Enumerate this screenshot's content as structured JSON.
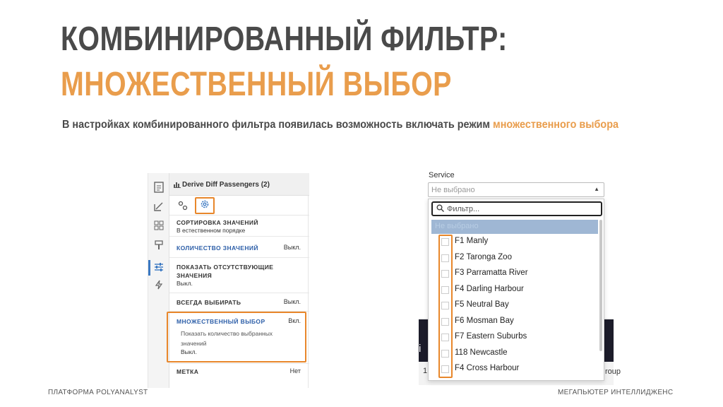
{
  "slide": {
    "title_line1": "КОМБИНИРОВАННЫЙ ФИЛЬТР:",
    "title_line2": "МНОЖЕСТВЕННЫЙ ВЫБОР",
    "subtitle_main": "В настройках комбинированного фильтра появилась возможность включать режим ",
    "subtitle_highlight": "множественного выбора",
    "footer_left": "ПЛАТФОРМА POLYANALYST",
    "footer_right": "МЕГАПЬЮТЕР ИНТЕЛЛИДЖЕНС",
    "accent_color": "#e99d4c"
  },
  "left_panel": {
    "node_title": "Derive Diff Passengers (2)",
    "options": [
      {
        "label": "СОРТИРОВКА ЗНАЧЕНИЙ",
        "sub": "В естественном порядке",
        "value": ""
      },
      {
        "label": "КОЛИЧЕСТВО ЗНАЧЕНИЙ",
        "sub": "",
        "value": "Выкл."
      },
      {
        "label": "ПОКАЗАТЬ ОТСУТСТВУЮЩИЕ",
        "label2": "ЗНАЧЕНИЯ",
        "sub": "Выкл.",
        "value": ""
      },
      {
        "label": "ВСЕГДА ВЫБИРАТЬ",
        "sub": "",
        "value": "Выкл."
      },
      {
        "label": "МНОЖЕСТВЕННЫЙ ВЫБОР",
        "sub1": "Показать количество выбранных",
        "sub2": "значений",
        "sub3": "Выкл.",
        "value": "Вкл."
      },
      {
        "label": "МЕТКА",
        "sub": "",
        "value": "Нет"
      }
    ]
  },
  "right_panel": {
    "service_label": "Service",
    "select_placeholder": "Не выбрано",
    "filter_placeholder": "Фильтр...",
    "selected_row": "Не выбрано",
    "items": [
      "F1 Manly",
      "F2 Taronga Zoo",
      "F3 Parramatta River",
      "F4 Darling Harbour",
      "F5 Neutral Bay",
      "F6 Mosman Bay",
      "F7 Eastern Suburbs",
      "118 Newcastle",
      "F4 Cross Harbour"
    ],
    "behind_text_1": "i",
    "behind_text_2": "1",
    "behind_text_3": "roup"
  }
}
